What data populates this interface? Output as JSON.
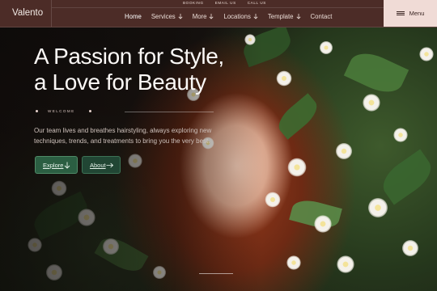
{
  "brand": {
    "name": "Valento"
  },
  "utility_links": [
    "BOOKING",
    "EMAIL US",
    "CALL US"
  ],
  "nav": {
    "items": [
      {
        "label": "Home",
        "active": true,
        "dropdown": false
      },
      {
        "label": "Services",
        "active": false,
        "dropdown": true
      },
      {
        "label": "More",
        "active": false,
        "dropdown": true
      },
      {
        "label": "Locations",
        "active": false,
        "dropdown": true
      },
      {
        "label": "Template",
        "active": false,
        "dropdown": true
      },
      {
        "label": "Contact",
        "active": false,
        "dropdown": false
      }
    ]
  },
  "menu_button": {
    "label": "Menu",
    "icon": "hamburger-icon"
  },
  "hero": {
    "headline_line1": "A Passion for Style,",
    "headline_line2": "a Love for Beauty",
    "eyebrow": "WELCOME",
    "intro": "Our team lives and breathes hairstyling, always exploring new techniques, trends, and treatments to bring you the very best.",
    "primary_button": {
      "label": "Explore",
      "icon": "arrow-down-icon"
    },
    "secondary_button": {
      "label": "About",
      "icon": "arrow-right-icon"
    }
  },
  "colors": {
    "topbar_bg": "#4c2c27",
    "menu_button_bg": "#f0dbd6",
    "primary_button_bg": "#2b5e42",
    "secondary_button_bg": "#214634"
  }
}
